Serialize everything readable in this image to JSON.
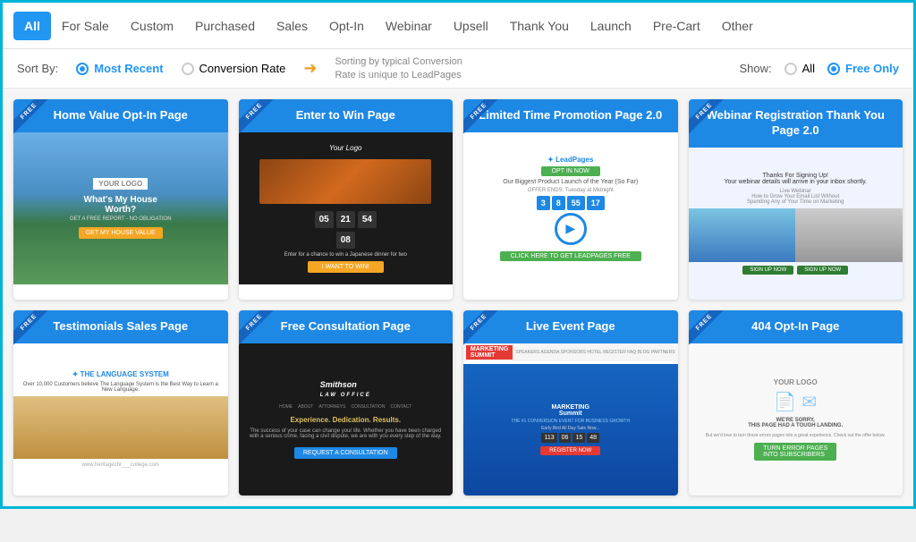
{
  "nav": {
    "items": [
      {
        "label": "All",
        "active": true
      },
      {
        "label": "For Sale",
        "active": false
      },
      {
        "label": "Custom",
        "active": false
      },
      {
        "label": "Purchased",
        "active": false
      },
      {
        "label": "Sales",
        "active": false
      },
      {
        "label": "Opt-In",
        "active": false
      },
      {
        "label": "Webinar",
        "active": false
      },
      {
        "label": "Upsell",
        "active": false
      },
      {
        "label": "Thank You",
        "active": false
      },
      {
        "label": "Launch",
        "active": false
      },
      {
        "label": "Pre-Cart",
        "active": false
      },
      {
        "label": "Other",
        "active": false
      }
    ]
  },
  "sortbar": {
    "sort_label": "Sort By:",
    "most_recent": "Most Recent",
    "conversion_rate": "Conversion Rate",
    "conversion_note": "Sorting by typical Conversion Rate is unique to LeadPages",
    "show_label": "Show:",
    "show_all": "All",
    "show_free": "Free Only"
  },
  "cards": [
    {
      "title": "Home Value Opt-In Page",
      "badge": "FREE",
      "type": "home-optin"
    },
    {
      "title": "Enter to Win Page",
      "badge": "FREE",
      "type": "enter-win"
    },
    {
      "title": "Limited Time Promotion Page 2.0",
      "badge": "FREE",
      "type": "promo"
    },
    {
      "title": "Webinar Registration Thank You Page 2.0",
      "badge": "FREE",
      "type": "webinar"
    },
    {
      "title": "Testimonials Sales Page",
      "badge": "FREE",
      "type": "testimonials"
    },
    {
      "title": "Free Consultation Page",
      "badge": "FREE",
      "type": "consultation"
    },
    {
      "title": "Live Event Page",
      "badge": "FREE",
      "type": "liveevent"
    },
    {
      "title": "404 Opt-In Page",
      "badge": "FREE",
      "type": "404optin"
    }
  ]
}
